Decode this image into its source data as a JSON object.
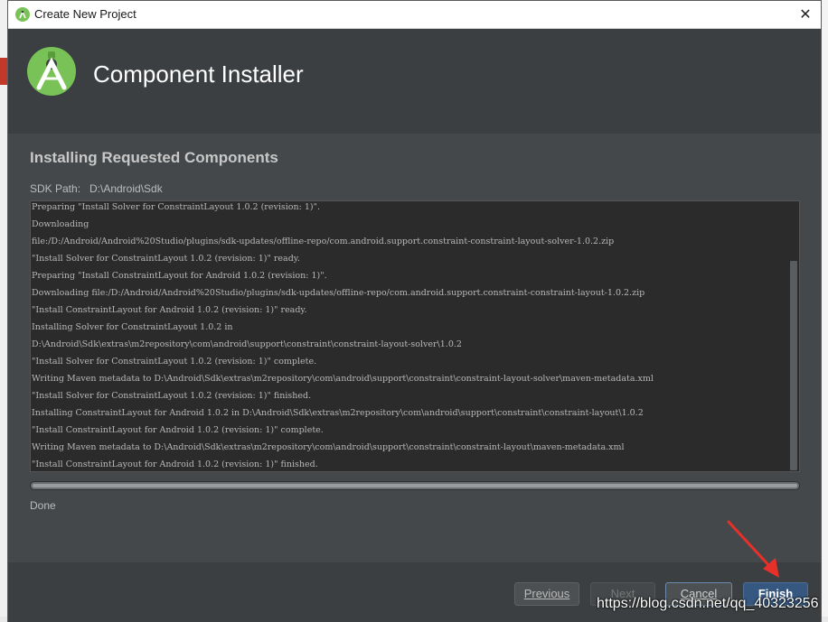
{
  "window": {
    "title": "Create New Project",
    "close_glyph": "✕"
  },
  "header": {
    "title": "Component Installer",
    "logo_icon": "android-studio-logo-icon"
  },
  "content": {
    "section_title": "Installing Requested Components",
    "sdk_path_label": "SDK Path:",
    "sdk_path_value": "D:\\Android\\Sdk",
    "log_lines": [
      "Preparing \"Install Solver for ConstraintLayout 1.0.2 (revision: 1)\".",
      "Downloading",
      "file:/D:/Android/Android%20Studio/plugins/sdk-updates/offline-repo/com.android.support.constraint-constraint-layout-solver-1.0.2.zip",
      "\"Install Solver for ConstraintLayout 1.0.2 (revision: 1)\" ready.",
      "Preparing \"Install ConstraintLayout for Android 1.0.2 (revision: 1)\".",
      "Downloading file:/D:/Android/Android%20Studio/plugins/sdk-updates/offline-repo/com.android.support.constraint-constraint-layout-1.0.2.zip",
      "\"Install ConstraintLayout for Android 1.0.2 (revision: 1)\" ready.",
      "Installing Solver for ConstraintLayout 1.0.2 in",
      "D:\\Android\\Sdk\\extras\\m2repository\\com\\android\\support\\constraint\\constraint-layout-solver\\1.0.2",
      "\"Install Solver for ConstraintLayout 1.0.2 (revision: 1)\" complete.",
      "Writing Maven metadata to D:\\Android\\Sdk\\extras\\m2repository\\com\\android\\support\\constraint\\constraint-layout-solver\\maven-metadata.xml",
      "\"Install Solver for ConstraintLayout 1.0.2 (revision: 1)\" finished.",
      "Installing ConstraintLayout for Android 1.0.2 in D:\\Android\\Sdk\\extras\\m2repository\\com\\android\\support\\constraint\\constraint-layout\\1.0.2",
      "\"Install ConstraintLayout for Android 1.0.2 (revision: 1)\" complete.",
      "Writing Maven metadata to D:\\Android\\Sdk\\extras\\m2repository\\com\\android\\support\\constraint\\constraint-layout\\maven-metadata.xml",
      "\"Install ConstraintLayout for Android 1.0.2 (revision: 1)\" finished."
    ],
    "progress_fraction": 1.0,
    "status": "Done"
  },
  "footer": {
    "previous_label": "Previous",
    "next_label": "Next",
    "cancel_label": "Cancel",
    "finish_label": "Finish"
  },
  "annotation": {
    "arrow_color": "#e8302a"
  },
  "watermark": "https://blog.csdn.net/qq_40323256",
  "colors": {
    "dialog_bg": "#3c3f41",
    "content_bg": "#45484a",
    "log_bg": "#2b2b2b",
    "primary_button": "#365880",
    "logo_green": "#78c257"
  }
}
